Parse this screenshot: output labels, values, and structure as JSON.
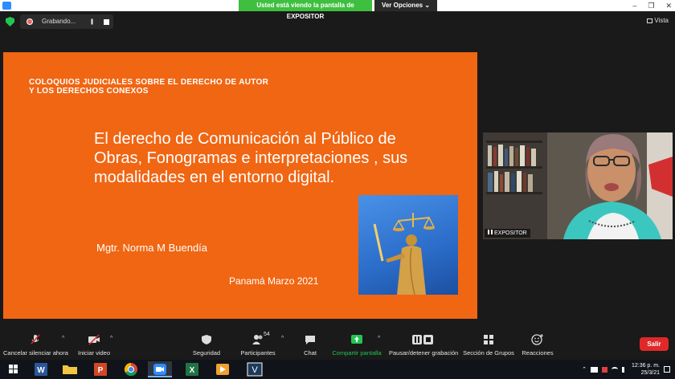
{
  "window": {
    "sharing_banner": "Usted está viendo la pantalla de EXPOSITOR",
    "view_options": "Ver Opciones",
    "view_options_caret": "⌄",
    "controls": [
      "–",
      "❐",
      "✕"
    ]
  },
  "recording": {
    "label": "Grabando...",
    "pause_glyph": "||",
    "view_label": "Vista"
  },
  "slide": {
    "header": "COLOQUIOS JUDICIALES SOBRE EL DERECHO DE AUTOR Y LOS DERECHOS CONEXOS",
    "title": "El derecho de Comunicación al Público de Obras, Fonogramas e interpretaciones , sus modalidades en el entorno digital.",
    "author": "Mgtr. Norma M Buendía",
    "date": "Panamá Marzo 2021"
  },
  "video": {
    "participant_name": "EXPOSITOR"
  },
  "toolbar": {
    "unmute": "Cancelar silenciar ahora",
    "start_video": "Iniciar video",
    "security": "Seguridad",
    "participants": "Participantes",
    "participants_count": "54",
    "chat": "Chat",
    "share_screen": "Compartir pantalla",
    "pause_recording": "Pausar/detener grabación",
    "breakout_rooms": "Sección de Grupos",
    "reactions": "Reacciones",
    "leave": "Salir",
    "caret": "^"
  },
  "taskbar": {
    "time": "12:36 p. m.",
    "date": "25/3/21",
    "word_letter": "W",
    "ppt_letter": "P",
    "excel_letter": "X",
    "vnc_letter": "V"
  },
  "colors": {
    "slide_orange": "#f06613",
    "banner_green": "#3fbf3f",
    "leave_red": "#e02828",
    "share_green": "#23c552"
  }
}
